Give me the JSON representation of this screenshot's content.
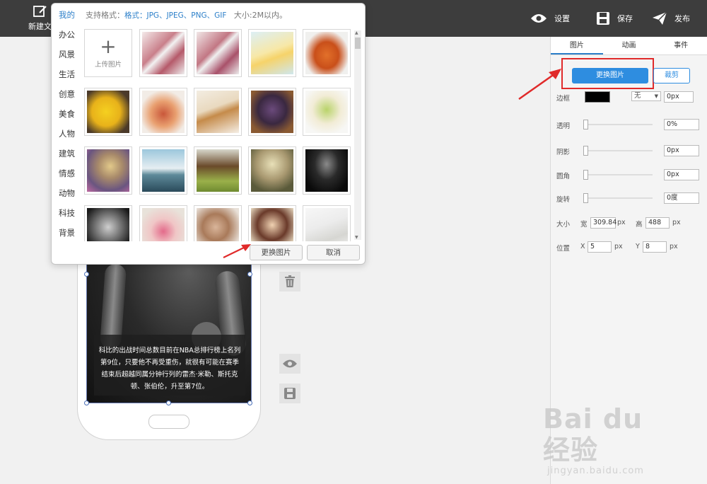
{
  "topbar": {
    "new_label": "新建文",
    "settings_label": "设置",
    "save_label": "保存",
    "publish_label": "发布"
  },
  "modal": {
    "categories": [
      "我的",
      "办公",
      "风景",
      "生活",
      "创意",
      "美食",
      "人物",
      "建筑",
      "情感",
      "动物",
      "科技",
      "背景"
    ],
    "active_category": "我的",
    "format_prefix": "支持格式：",
    "format_highlight": "格式：JPG、JPEG、PNG、GIF",
    "size_hint": "大小:2M以内。",
    "upload_label": "上传图片",
    "replace_button": "更换图片",
    "cancel_button": "取消"
  },
  "panel": {
    "tabs": [
      "图片",
      "动画",
      "事件"
    ],
    "replace_button": "更换图片",
    "crop_button": "裁剪",
    "border_label": "边框",
    "border_color": "#000000",
    "border_style": "无",
    "border_width": "0px",
    "opacity_label": "透明",
    "opacity_value": "0%",
    "shadow_label": "阴影",
    "shadow_value": "0px",
    "radius_label": "圆角",
    "radius_value": "0px",
    "rotate_label": "旋转",
    "rotate_value": "0度",
    "size_label": "大小",
    "width_label": "宽",
    "width_value": "309.84",
    "height_label": "高",
    "height_value": "488",
    "position_label": "位置",
    "x_label": "X",
    "x_value": "5",
    "y_label": "Y",
    "y_value": "8",
    "px_unit": "px"
  },
  "canvas": {
    "photo_text": "科比的出战时间总数目前在NBA总排行榜上名列第9位，只要他不再受重伤，就很有可能在赛季结束后超越同属分钟行列的雷杰·米勒、斯托克顿、张伯伦，升至第7位。"
  },
  "watermark": {
    "brand": "Bai du 经验",
    "url": "jingyan.baidu.com"
  }
}
